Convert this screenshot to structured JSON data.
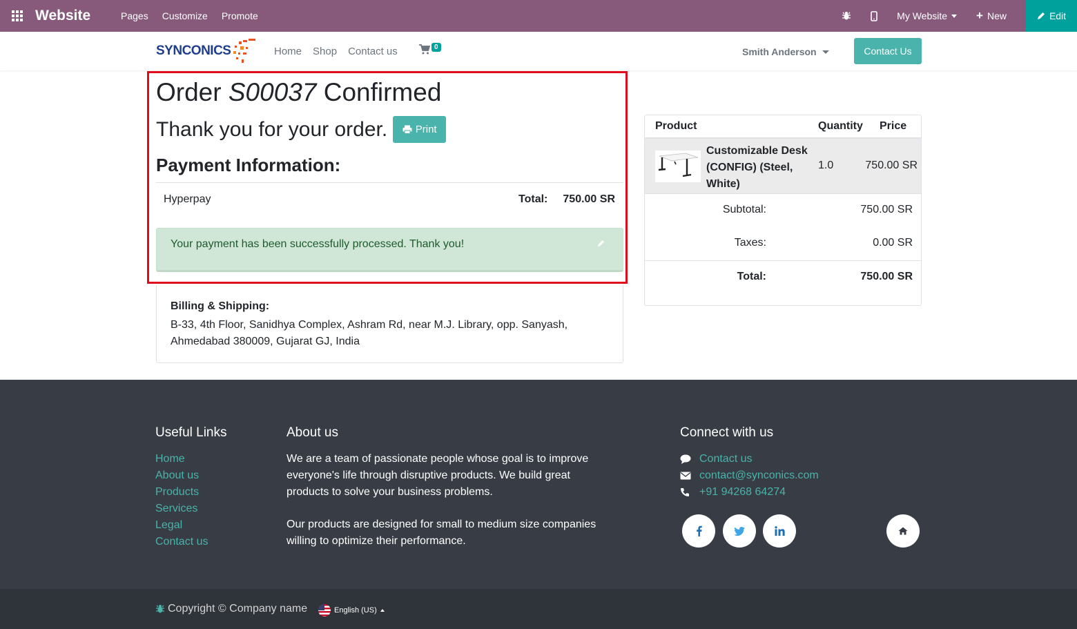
{
  "topbar": {
    "brand": "Website",
    "menu": [
      "Pages",
      "Customize",
      "Promote"
    ],
    "website_selector": "My Website",
    "new_label": "New",
    "edit_label": "Edit",
    "bg_color": "#875a7b",
    "edit_color": "#00a09d"
  },
  "nav": {
    "logo_text": "SYNCONICS",
    "links": [
      "Home",
      "Shop",
      "Contact us"
    ],
    "cart_count": "0",
    "user_name": "Smith Anderson",
    "contact_button": "Contact Us",
    "accent_color": "#4ab3ab"
  },
  "order": {
    "title_prefix": "Order",
    "order_number": "S00037",
    "title_suffix": "Confirmed",
    "thank_you": "Thank you for your order.",
    "print_label": "Print",
    "payment_title": "Payment Information:",
    "payment_method": "Hyperpay",
    "total_label": "Total:",
    "total_value": "750.00 SR",
    "success_message": "Your payment has been successfully processed. Thank you!",
    "billing_label": "Billing & Shipping:",
    "billing_address": "B-33, 4th Floor, Sanidhya Complex, Ashram Rd, near M.J. Library, opp. Sanyash, Ahmedabad 380009, Gujarat GJ, India",
    "highlight_color": "#e00b1c"
  },
  "summary": {
    "headers": [
      "Product",
      "Quantity",
      "Price"
    ],
    "product_name": "Customizable Desk (CONFIG) (Steel, White)",
    "product_quantity": "1.0",
    "product_price": "750.00 SR",
    "subtotal_label": "Subtotal:",
    "subtotal_value": "750.00 SR",
    "taxes_label": "Taxes:",
    "taxes_value": "0.00 SR",
    "total_label": "Total:",
    "total_value": "750.00 SR"
  },
  "footer": {
    "useful_links_title": "Useful Links",
    "useful_links": [
      "Home",
      "About us",
      "Products",
      "Services",
      "Legal",
      "Contact us"
    ],
    "about_title": "About us",
    "about_p1": "We are a team of passionate people whose goal is to improve everyone's life through disruptive products. We build great products to solve your business problems.",
    "about_p2": "Our products are designed for small to medium size companies willing to optimize their performance.",
    "connect_title": "Connect with us",
    "connect_contact": "Contact us",
    "connect_email": "contact@synconics.com",
    "connect_phone": "+91 94268 64274",
    "copyright": "Copyright © Company name",
    "language": "English (US)",
    "bg_color": "#373c45"
  }
}
